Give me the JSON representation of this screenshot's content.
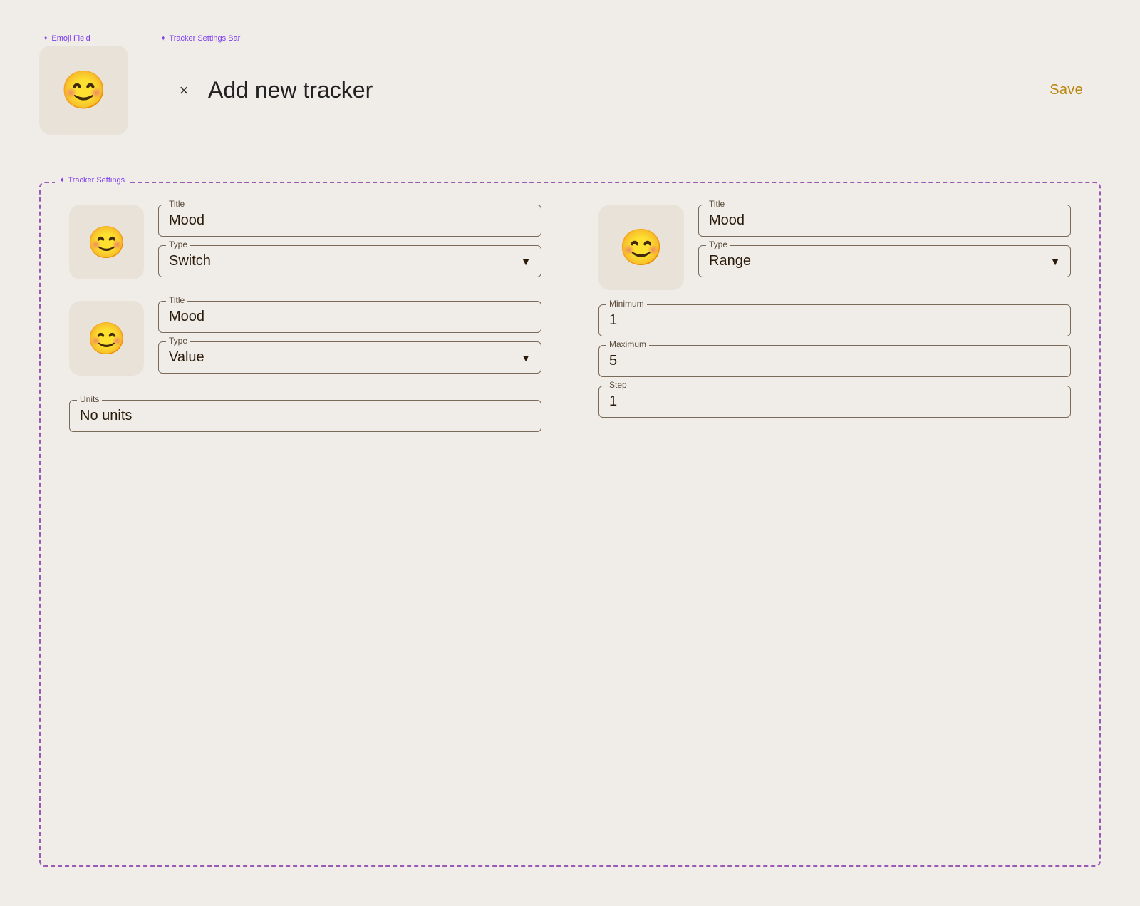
{
  "annotations": {
    "emoji_field_label": "Emoji Field",
    "tracker_settings_bar_label": "Tracker Settings Bar",
    "tracker_settings_label": "Tracker Settings"
  },
  "header": {
    "close_label": "×",
    "title": "Add new tracker",
    "save_label": "Save"
  },
  "emoji": "😊",
  "tracker1": {
    "title_label": "Title",
    "title_value": "Mood",
    "type_label": "Type",
    "type_value": "Switch"
  },
  "tracker2": {
    "title_label": "Title",
    "title_value": "Mood",
    "type_label": "Type",
    "type_value": "Value",
    "units_label": "Units",
    "units_value": "No units"
  },
  "tracker3": {
    "title_label": "Title",
    "title_value": "Mood",
    "type_label": "Type",
    "type_value": "Range",
    "min_label": "Minimum",
    "min_value": "1",
    "max_label": "Maximum",
    "max_value": "5",
    "step_label": "Step",
    "step_value": "1"
  }
}
